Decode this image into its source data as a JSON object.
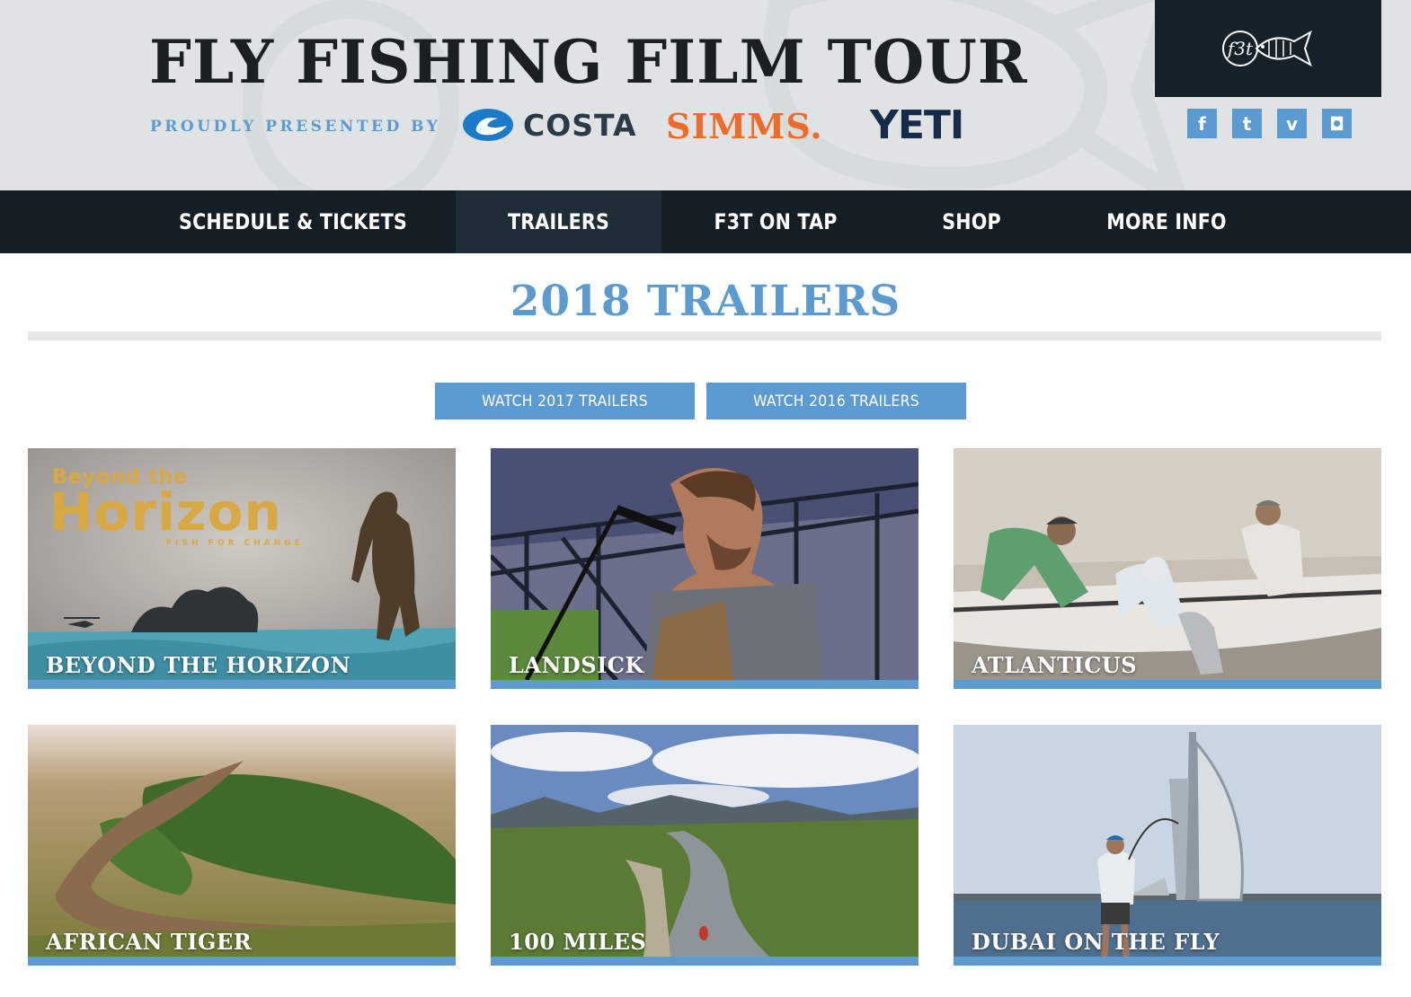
{
  "header": {
    "title": "FLY FISHING FILM TOUR",
    "presented_by": "PROUDLY PRESENTED BY",
    "sponsors": {
      "costa": "COSTA",
      "simms": "SIMMS.",
      "yeti": "YETI"
    },
    "logo_text": "f3t",
    "socials": [
      {
        "icon": "facebook-icon",
        "glyph": "f"
      },
      {
        "icon": "twitter-icon",
        "glyph": "t"
      },
      {
        "icon": "vimeo-icon",
        "glyph": "v"
      },
      {
        "icon": "instagram-icon",
        "glyph": "◘"
      }
    ]
  },
  "nav": {
    "items": [
      {
        "label": "SCHEDULE & TICKETS"
      },
      {
        "label": "TRAILERS",
        "active": true
      },
      {
        "label": "F3T ON TAP"
      },
      {
        "label": "SHOP"
      },
      {
        "label": "MORE INFO"
      }
    ]
  },
  "main": {
    "section_title": "2018 TRAILERS",
    "archive_buttons": [
      {
        "label": "WATCH 2017 TRAILERS"
      },
      {
        "label": "WATCH 2016 TRAILERS"
      }
    ],
    "trailers": [
      {
        "title": "BEYOND THE HORIZON",
        "poster_small": "Beyond the",
        "poster_big": "Horizon",
        "poster_tag": "FISH FOR CHANGE"
      },
      {
        "title": "LANDSICK"
      },
      {
        "title": "ATLANTICUS"
      },
      {
        "title": "AFRICAN TIGER"
      },
      {
        "title": "100 MILES"
      },
      {
        "title": "DUBAI ON THE FLY"
      }
    ]
  },
  "colors": {
    "accent": "#5c9bd1",
    "nav_bg": "#141e24",
    "header_bg": "#dfe3e3",
    "simms_orange": "#ef6b2a",
    "yeti_navy": "#162b47"
  }
}
